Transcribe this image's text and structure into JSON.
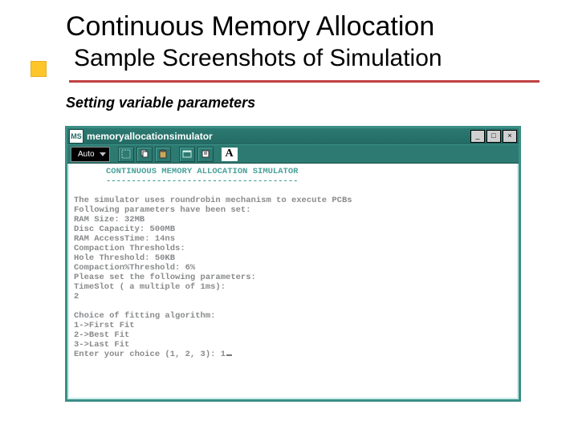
{
  "slide": {
    "title1": "Continuous Memory Allocation",
    "title2": "Sample Screenshots of Simulation",
    "caption": "Setting variable parameters"
  },
  "window": {
    "title": "memoryallocationsimulator",
    "sysicon": "MS",
    "combo_value": "Auto",
    "font_sample": "A"
  },
  "console": {
    "header": "CONTINUOUS MEMORY ALLOCATION SIMULATOR",
    "dashes": "--------------------------------------",
    "lines": [
      "",
      "The simulator uses roundrobin mechanism to execute PCBs",
      "Following parameters have been set:",
      "RAM Size: 32MB",
      "Disc Capacity: 500MB",
      "RAM AccessTime: 14ns",
      "Compaction Thresholds:",
      "Hole Threshold: 50KB",
      "Compaction%Threshold: 6%",
      "Please set the following parameters:",
      "TimeSlot ( a multiple of 1ms):",
      "2",
      "",
      "Choice of fitting algorithm:",
      "1->First Fit",
      "2->Best Fit",
      "3->Last Fit",
      "Enter your choice (1, 2, 3): 1"
    ]
  }
}
